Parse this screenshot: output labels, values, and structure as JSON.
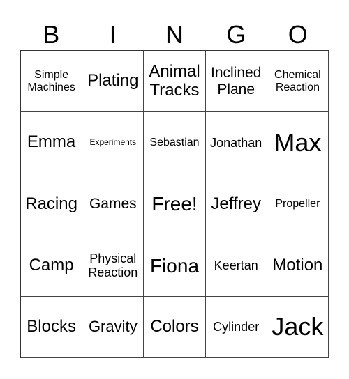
{
  "header": [
    "B",
    "I",
    "N",
    "G",
    "O"
  ],
  "cells": [
    [
      "Simple Machines",
      "Plating",
      "Animal Tracks",
      "Inclined Plane",
      "Chemical Reaction"
    ],
    [
      "Emma",
      "Experiments",
      "Sebastian",
      "Jonathan",
      "Max"
    ],
    [
      "Racing",
      "Games",
      "Free!",
      "Jeffrey",
      "Propeller"
    ],
    [
      "Camp",
      "Physical Reaction",
      "Fiona",
      "Keertan",
      "Motion"
    ],
    [
      "Blocks",
      "Gravity",
      "Colors",
      "Cylinder",
      "Jack"
    ]
  ]
}
